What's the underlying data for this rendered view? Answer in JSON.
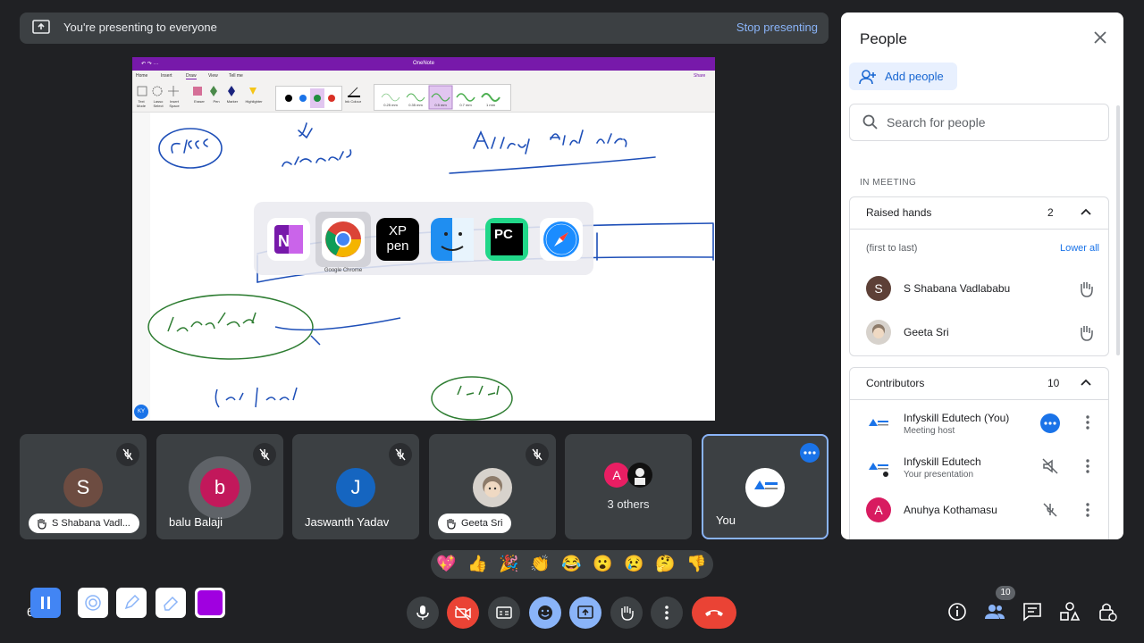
{
  "banner": {
    "text": "You're presenting to everyone",
    "stop": "Stop presenting"
  },
  "screen": {
    "app_title": "OneNote",
    "menu": [
      "Home",
      "Insert",
      "Draw",
      "View",
      "Tell me"
    ],
    "share": "Share",
    "ribbon_tools": [
      "Text Mode",
      "Lasso Select",
      "Insert Space",
      "Eraser",
      "Pen",
      "Marker",
      "Highlighter"
    ],
    "ink_label": "Ink Colour",
    "pen_sizes": [
      "0.25 mm",
      "0.35 mm",
      "0.5 mm",
      "0.7 mm",
      "1 mm"
    ],
    "user_badge": "KY",
    "switcher_caption": "Google Chrome",
    "xp_top": "XP",
    "xp_bottom": "pen",
    "pc": "PC"
  },
  "tiles": [
    {
      "initial": "S",
      "name": "S Shabana Vadl...",
      "color": "#6d4c41"
    },
    {
      "initial": "b",
      "name": "balu Balaji",
      "color": "#c2185b"
    },
    {
      "initial": "J",
      "name": "Jaswanth Yadav",
      "color": "#1565c0"
    },
    {
      "initial": "",
      "name": "Geeta Sri",
      "color": "#bdbdbd"
    },
    {
      "initial": "A",
      "name": "3 others",
      "color": "#e91e63"
    },
    {
      "initial": "",
      "name": "You",
      "color": "#ffffff"
    }
  ],
  "reactions": [
    "💖",
    "👍",
    "🎉",
    "👏",
    "😂",
    "😮",
    "😢",
    "🤔",
    "👎"
  ],
  "clock": "6:  M",
  "participants_badge": "10",
  "people": {
    "title": "People",
    "add_people": "Add people",
    "search_placeholder": "Search for people",
    "in_meeting": "IN MEETING",
    "raised_hands": {
      "label": "Raised hands",
      "count": "2",
      "order": "(first to last)",
      "lower_all": "Lower all"
    },
    "raised_list": [
      {
        "initial": "S",
        "name": "S Shabana Vadlababu",
        "color": "#5d4037"
      },
      {
        "initial": "",
        "name": "Geeta Sri",
        "color": "#bdbdbd"
      }
    ],
    "contributors": {
      "label": "Contributors",
      "count": "10"
    },
    "contributor_list": [
      {
        "name": "Infyskill Edutech (You)",
        "sub": "Meeting host"
      },
      {
        "name": "Infyskill Edutech",
        "sub": "Your presentation"
      },
      {
        "initial": "A",
        "name": "Anuhya Kothamasu",
        "color": "#d81b60"
      }
    ]
  }
}
